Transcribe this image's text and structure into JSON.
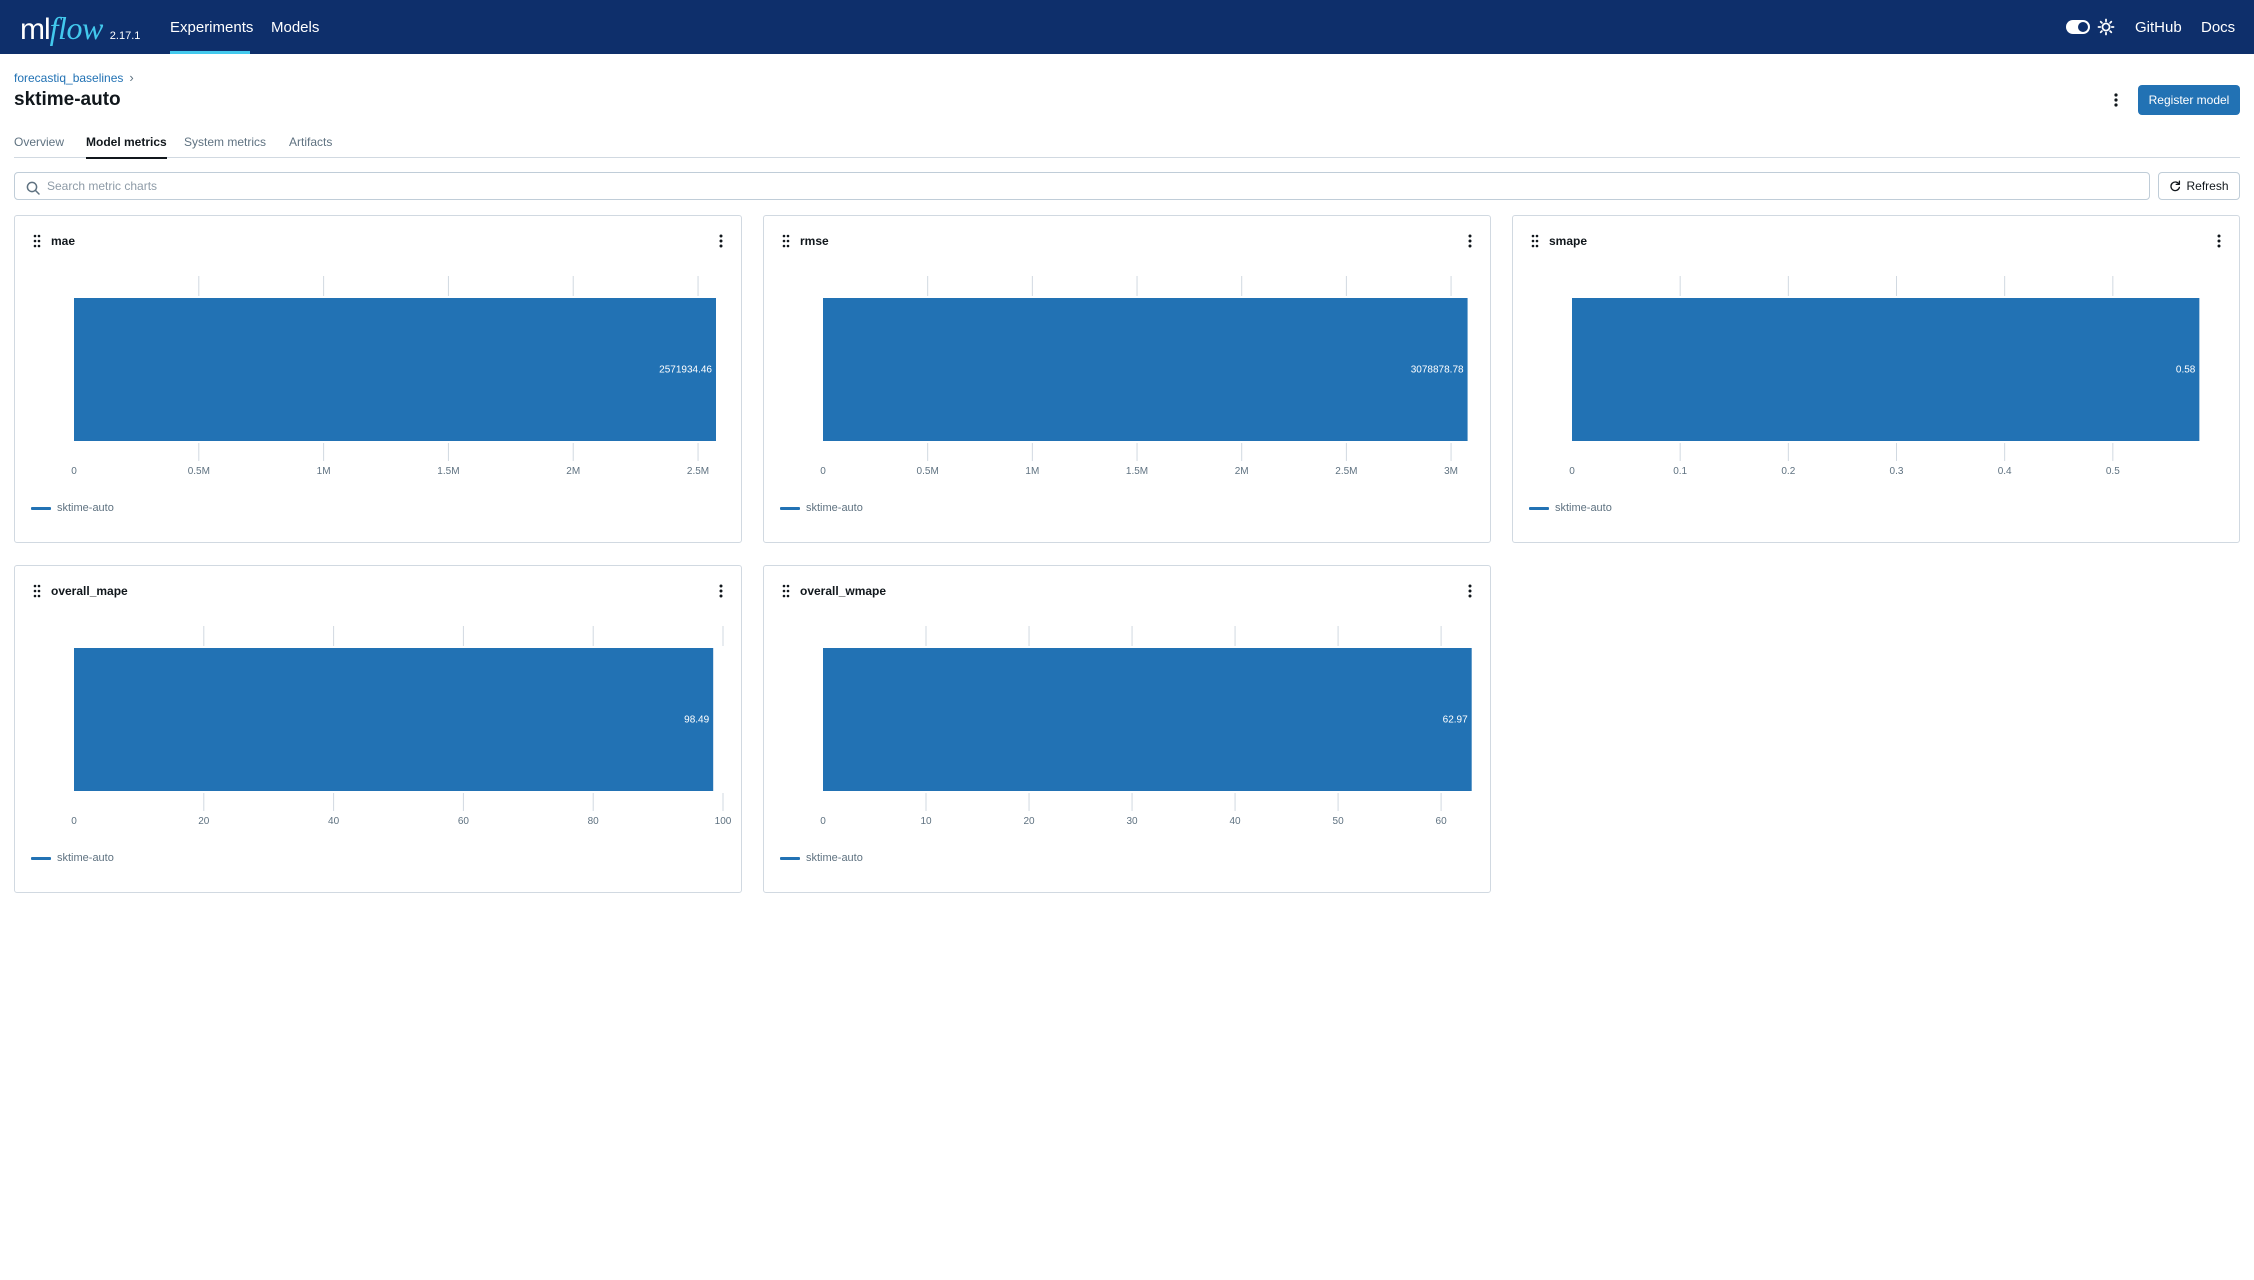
{
  "nav": {
    "logo_ml": "ml",
    "logo_flow": "flow",
    "version": "2.17.1",
    "experiments": "Experiments",
    "models": "Models",
    "github": "GitHub",
    "docs": "Docs"
  },
  "header": {
    "breadcrumb": "forecastiq_baselines",
    "title": "sktime-auto",
    "register_label": "Register model"
  },
  "tabs": [
    "Overview",
    "Model metrics",
    "System metrics",
    "Artifacts"
  ],
  "active_tab": "Model metrics",
  "search": {
    "placeholder": "Search metric charts"
  },
  "refresh_label": "Refresh",
  "colors": {
    "nav_bg": "#0e2f6b",
    "accent": "#2272b4",
    "logo_accent": "#43c9ed"
  },
  "chart_data": [
    {
      "type": "bar",
      "title": "mae",
      "orientation": "horizontal",
      "categories": [
        "sktime-auto"
      ],
      "values": [
        2571934.46
      ],
      "value_label": "2571934.46",
      "xlim": [
        0,
        2600000
      ],
      "xticks": [
        0,
        500000,
        1000000,
        1500000,
        2000000,
        2500000
      ],
      "xtick_labels": [
        "0",
        "0.5M",
        "1M",
        "1.5M",
        "2M",
        "2.5M"
      ],
      "legend": [
        "sktime-auto"
      ],
      "grid": true
    },
    {
      "type": "bar",
      "title": "rmse",
      "orientation": "horizontal",
      "categories": [
        "sktime-auto"
      ],
      "values": [
        3078878.78
      ],
      "value_label": "3078878.78",
      "xlim": [
        0,
        3100000
      ],
      "xticks": [
        0,
        500000,
        1000000,
        1500000,
        2000000,
        2500000,
        3000000
      ],
      "xtick_labels": [
        "0",
        "0.5M",
        "1M",
        "1.5M",
        "2M",
        "2.5M",
        "3M"
      ],
      "legend": [
        "sktime-auto"
      ],
      "grid": true
    },
    {
      "type": "bar",
      "title": "smape",
      "orientation": "horizontal",
      "categories": [
        "sktime-auto"
      ],
      "values": [
        0.58
      ],
      "value_label": "0.58",
      "xlim": [
        0,
        0.6
      ],
      "xticks": [
        0,
        0.1,
        0.2,
        0.3,
        0.4,
        0.5
      ],
      "xtick_labels": [
        "0",
        "0.1",
        "0.2",
        "0.3",
        "0.4",
        "0.5"
      ],
      "legend": [
        "sktime-auto"
      ],
      "grid": true
    },
    {
      "type": "bar",
      "title": "overall_mape",
      "orientation": "horizontal",
      "categories": [
        "sktime-auto"
      ],
      "values": [
        98.49
      ],
      "value_label": "98.49",
      "xlim": [
        0,
        100
      ],
      "xticks": [
        0,
        20,
        40,
        60,
        80,
        100
      ],
      "xtick_labels": [
        "0",
        "20",
        "40",
        "60",
        "80",
        "100"
      ],
      "legend": [
        "sktime-auto"
      ],
      "grid": true
    },
    {
      "type": "bar",
      "title": "overall_wmape",
      "orientation": "horizontal",
      "categories": [
        "sktime-auto"
      ],
      "values": [
        62.97
      ],
      "value_label": "62.97",
      "xlim": [
        0,
        63
      ],
      "xticks": [
        0,
        10,
        20,
        30,
        40,
        50,
        60
      ],
      "xtick_labels": [
        "0",
        "10",
        "20",
        "30",
        "40",
        "50",
        "60"
      ],
      "legend": [
        "sktime-auto"
      ],
      "grid": true
    }
  ]
}
